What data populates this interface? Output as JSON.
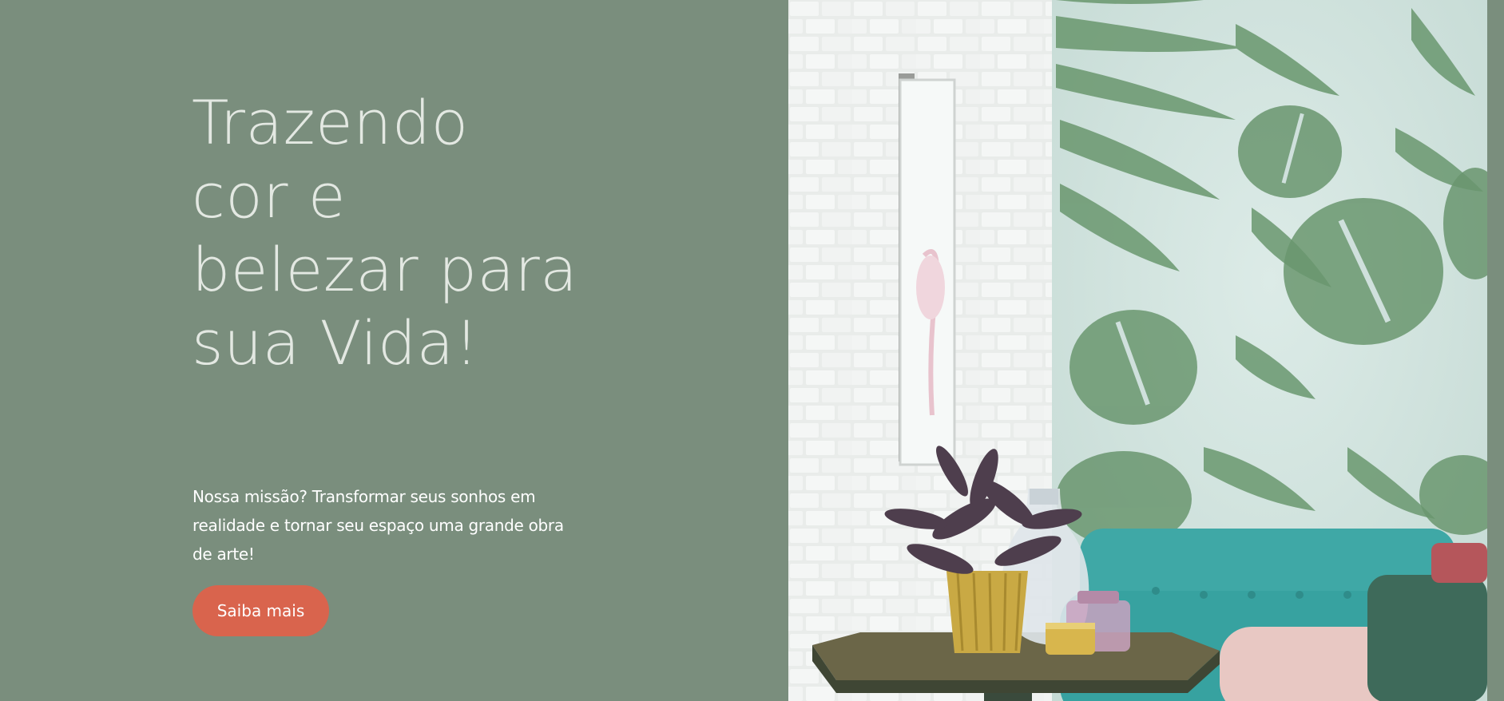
{
  "hero": {
    "headline_lines": [
      "Trazendo",
      "cor e",
      "belezar para",
      "sua Vida!"
    ],
    "mission_text": "Nossa missão? Transformar seus sonhos em realidade e tornar seu espaço uma grande obra de arte!",
    "cta_label": "Saiba mais"
  },
  "colors": {
    "background": "#7a8e7d",
    "headline": "#e3e8e2",
    "cta": "#d9644d",
    "sofa": "#3fa8a6",
    "leaves": "#6f9b74"
  },
  "image": {
    "icon": "interior-photo-icon"
  }
}
